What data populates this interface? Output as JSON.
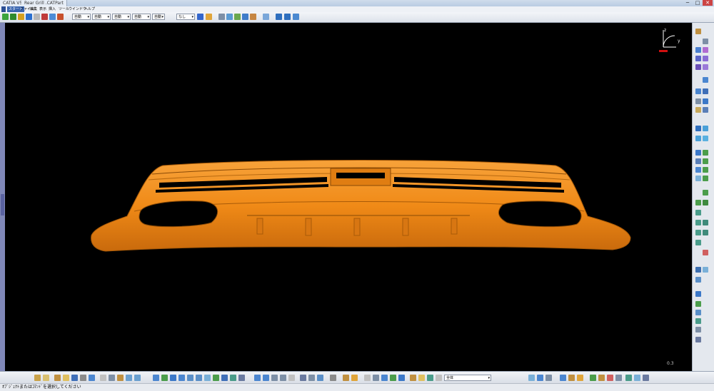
{
  "window": {
    "app_title": "CATIA V5",
    "tabs": [
      "CATIA V5",
      "Rear Grill .CATPart"
    ],
    "controls": [
      "─",
      "□",
      "✕"
    ]
  },
  "menubar": {
    "items": [
      "スタート",
      "ファイル",
      "編集",
      "表示",
      "挿入",
      "ツール",
      "ウインドウ",
      "ヘルプ"
    ]
  },
  "toolbar": {
    "combos": [
      {
        "id": "combo1",
        "value": "自動"
      },
      {
        "id": "combo2",
        "value": "自動"
      },
      {
        "id": "combo3",
        "value": "自動"
      },
      {
        "id": "combo4",
        "value": "自動"
      },
      {
        "id": "combo5",
        "value": "自動"
      },
      {
        "id": "combo6",
        "value": "なし"
      }
    ]
  },
  "viewport": {
    "scale_readout": "0.3",
    "compass": {
      "z_label": "z",
      "y_label": "y"
    },
    "model_color": "#f08a17"
  },
  "bottom_toolbar": {
    "filter_combo": "全体"
  },
  "status": {
    "message": "ｵﾌﾞｼﾞｪｸﾄまたはｺﾏﾝﾄﾞを選択してください"
  }
}
